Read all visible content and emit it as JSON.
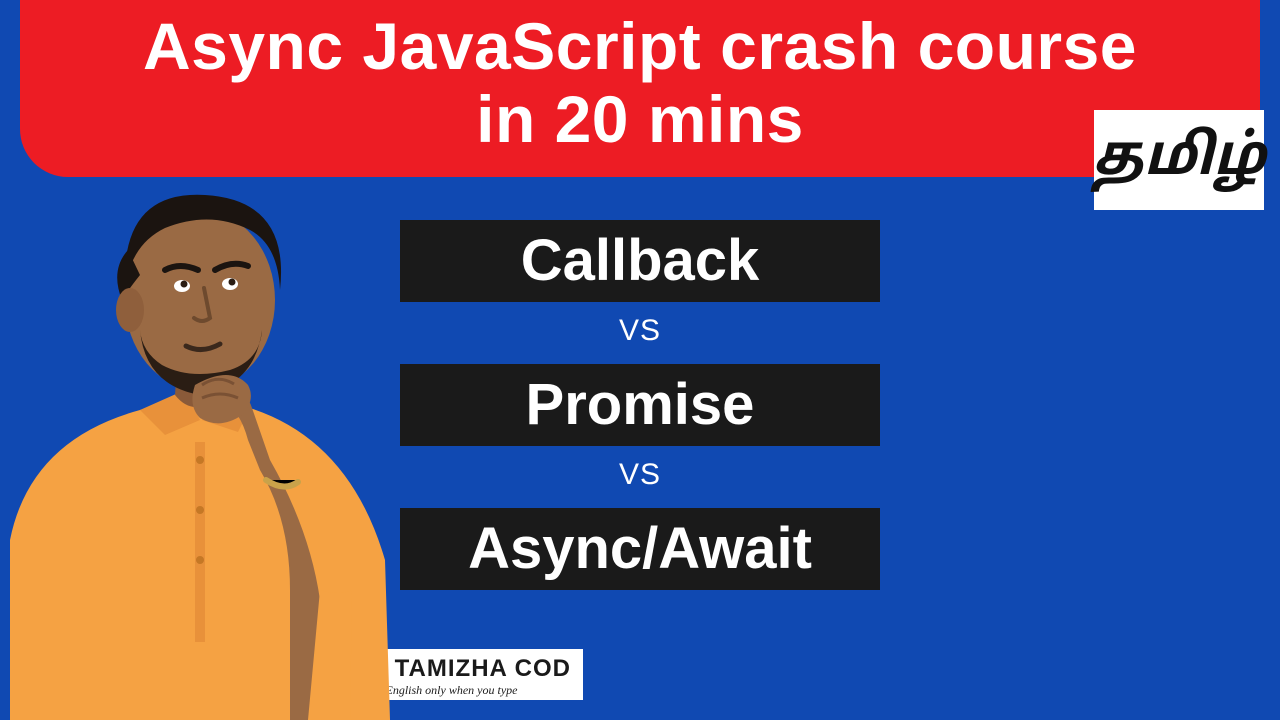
{
  "colors": {
    "bg": "#1049b2",
    "banner": "#ed1c24",
    "bar": "#1a1a1a",
    "white": "#ffffff"
  },
  "banner": {
    "line1": "Async JavaScript crash course",
    "line2": "in 20 mins"
  },
  "tamil_badge": "தமிழ்",
  "topics": {
    "item1": "Callback",
    "vs1": "VS",
    "item2": "Promise",
    "vs2": "VS",
    "item3": "Async/Await"
  },
  "footer": {
    "line1": "ODE TAMIZHA COD",
    "line2": "English only when you type"
  }
}
